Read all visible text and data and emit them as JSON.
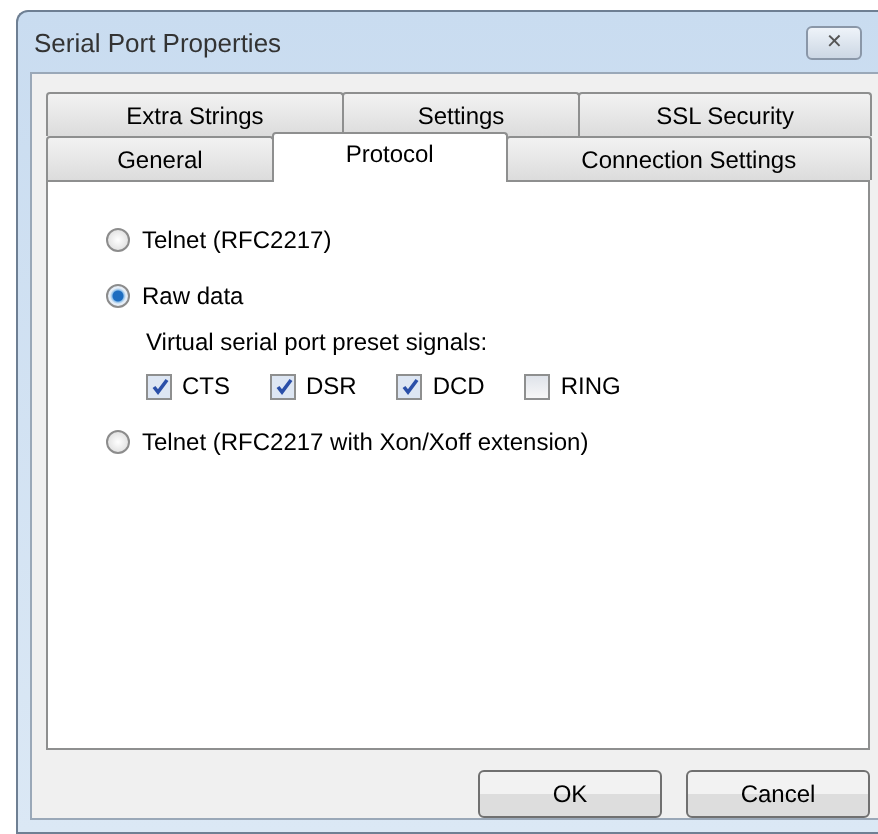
{
  "window": {
    "title": "Serial Port Properties",
    "close_symbol": "✕"
  },
  "tab_rows": [
    [
      {
        "label": "Extra Strings",
        "selected": false
      },
      {
        "label": "Settings",
        "selected": false
      },
      {
        "label": "SSL Security",
        "selected": false
      }
    ],
    [
      {
        "label": "General",
        "selected": false
      },
      {
        "label": "Protocol",
        "selected": true
      },
      {
        "label": "Connection Settings",
        "selected": false
      }
    ]
  ],
  "protocol_options": [
    {
      "label": "Telnet (RFC2217)",
      "selected": false
    },
    {
      "label": "Raw data",
      "selected": true,
      "preset_signals": {
        "label": "Virtual serial port preset signals:",
        "signals": [
          {
            "label": "CTS",
            "checked": true
          },
          {
            "label": "DSR",
            "checked": true
          },
          {
            "label": "DCD",
            "checked": true
          },
          {
            "label": "RING",
            "checked": false
          }
        ]
      }
    },
    {
      "label": "Telnet (RFC2217 with Xon/Xoff extension)",
      "selected": false
    }
  ],
  "buttons": [
    "OK",
    "Cancel"
  ]
}
